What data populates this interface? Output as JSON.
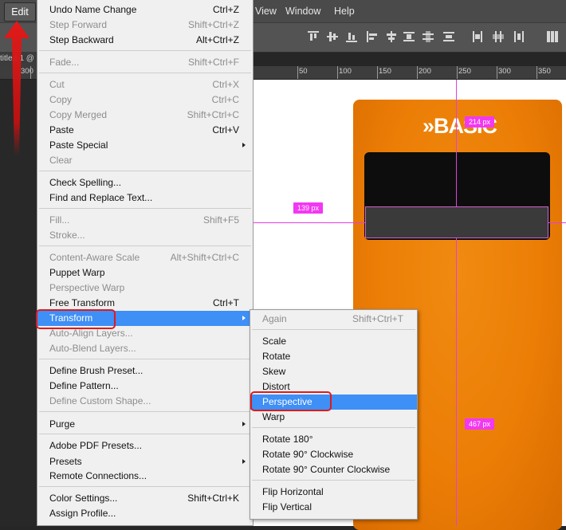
{
  "menubar": {
    "edit": "Edit",
    "items": [
      "View",
      "Window",
      "Help"
    ]
  },
  "doc_tab": "titled-1 @",
  "ruler": {
    "labels": [
      "300",
      "50",
      "100",
      "150",
      "200",
      "250",
      "300",
      "350"
    ]
  },
  "canvas": {
    "device_title": "»BASIC",
    "measure_top": "214 px",
    "measure_left": "139 px",
    "measure_bottom": "467 px",
    "accent_color": "#ec7e06",
    "guide_color": "#e040e0"
  },
  "edit_menu": {
    "items": [
      {
        "label": "Undo Name Change",
        "shortcut": "Ctrl+Z",
        "enabled": true
      },
      {
        "label": "Step Forward",
        "shortcut": "Shift+Ctrl+Z",
        "enabled": false
      },
      {
        "label": "Step Backward",
        "shortcut": "Alt+Ctrl+Z",
        "enabled": true
      },
      {
        "label": "Fade...",
        "shortcut": "Shift+Ctrl+F",
        "enabled": false
      },
      {
        "label": "Cut",
        "shortcut": "Ctrl+X",
        "enabled": false
      },
      {
        "label": "Copy",
        "shortcut": "Ctrl+C",
        "enabled": false
      },
      {
        "label": "Copy Merged",
        "shortcut": "Shift+Ctrl+C",
        "enabled": false
      },
      {
        "label": "Paste",
        "shortcut": "Ctrl+V",
        "enabled": true
      },
      {
        "label": "Paste Special",
        "shortcut": "",
        "enabled": true,
        "submenu": true
      },
      {
        "label": "Clear",
        "shortcut": "",
        "enabled": false
      },
      {
        "label": "Check Spelling...",
        "shortcut": "",
        "enabled": true
      },
      {
        "label": "Find and Replace Text...",
        "shortcut": "",
        "enabled": true
      },
      {
        "label": "Fill...",
        "shortcut": "Shift+F5",
        "enabled": false
      },
      {
        "label": "Stroke...",
        "shortcut": "",
        "enabled": false
      },
      {
        "label": "Content-Aware Scale",
        "shortcut": "Alt+Shift+Ctrl+C",
        "enabled": false
      },
      {
        "label": "Puppet Warp",
        "shortcut": "",
        "enabled": true
      },
      {
        "label": "Perspective Warp",
        "shortcut": "",
        "enabled": false
      },
      {
        "label": "Free Transform",
        "shortcut": "Ctrl+T",
        "enabled": true
      },
      {
        "label": "Transform",
        "shortcut": "",
        "enabled": true,
        "submenu": true,
        "selected": true
      },
      {
        "label": "Auto-Align Layers...",
        "shortcut": "",
        "enabled": false
      },
      {
        "label": "Auto-Blend Layers...",
        "shortcut": "",
        "enabled": false
      },
      {
        "label": "Define Brush Preset...",
        "shortcut": "",
        "enabled": true
      },
      {
        "label": "Define Pattern...",
        "shortcut": "",
        "enabled": true
      },
      {
        "label": "Define Custom Shape...",
        "shortcut": "",
        "enabled": false
      },
      {
        "label": "Purge",
        "shortcut": "",
        "enabled": true,
        "submenu": true
      },
      {
        "label": "Adobe PDF Presets...",
        "shortcut": "",
        "enabled": true
      },
      {
        "label": "Presets",
        "shortcut": "",
        "enabled": true,
        "submenu": true
      },
      {
        "label": "Remote Connections...",
        "shortcut": "",
        "enabled": true
      },
      {
        "label": "Color Settings...",
        "shortcut": "Shift+Ctrl+K",
        "enabled": true
      },
      {
        "label": "Assign Profile...",
        "shortcut": "",
        "enabled": true
      }
    ]
  },
  "transform_menu": {
    "items": [
      {
        "label": "Again",
        "shortcut": "Shift+Ctrl+T",
        "enabled": false
      },
      {
        "label": "Scale",
        "shortcut": "",
        "enabled": true
      },
      {
        "label": "Rotate",
        "shortcut": "",
        "enabled": true
      },
      {
        "label": "Skew",
        "shortcut": "",
        "enabled": true
      },
      {
        "label": "Distort",
        "shortcut": "",
        "enabled": true
      },
      {
        "label": "Perspective",
        "shortcut": "",
        "enabled": true,
        "selected": true
      },
      {
        "label": "Warp",
        "shortcut": "",
        "enabled": true
      },
      {
        "label": "Rotate 180°",
        "shortcut": "",
        "enabled": true
      },
      {
        "label": "Rotate 90° Clockwise",
        "shortcut": "",
        "enabled": true
      },
      {
        "label": "Rotate 90° Counter Clockwise",
        "shortcut": "",
        "enabled": true
      },
      {
        "label": "Flip Horizontal",
        "shortcut": "",
        "enabled": true
      },
      {
        "label": "Flip Vertical",
        "shortcut": "",
        "enabled": true
      }
    ]
  }
}
